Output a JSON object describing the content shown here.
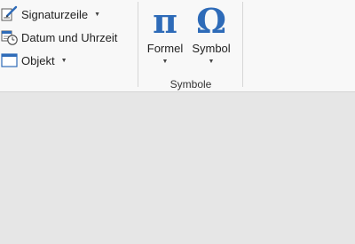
{
  "ribbon": {
    "text_group": {
      "items": [
        {
          "label": "Signaturzeile",
          "icon": "signature-line-icon",
          "has_dropdown": true
        },
        {
          "label": "Datum und Uhrzeit",
          "icon": "date-time-icon",
          "has_dropdown": false
        },
        {
          "label": "Objekt",
          "icon": "object-icon",
          "has_dropdown": true
        }
      ]
    },
    "symbols_group": {
      "label": "Symbole",
      "buttons": [
        {
          "glyph": "π",
          "label": "Formel",
          "icon": "formula-icon",
          "has_dropdown": true
        },
        {
          "glyph": "Ω",
          "label": "Symbol",
          "icon": "symbol-icon",
          "has_dropdown": true
        }
      ]
    },
    "accent_color": "#2e6bb8"
  }
}
